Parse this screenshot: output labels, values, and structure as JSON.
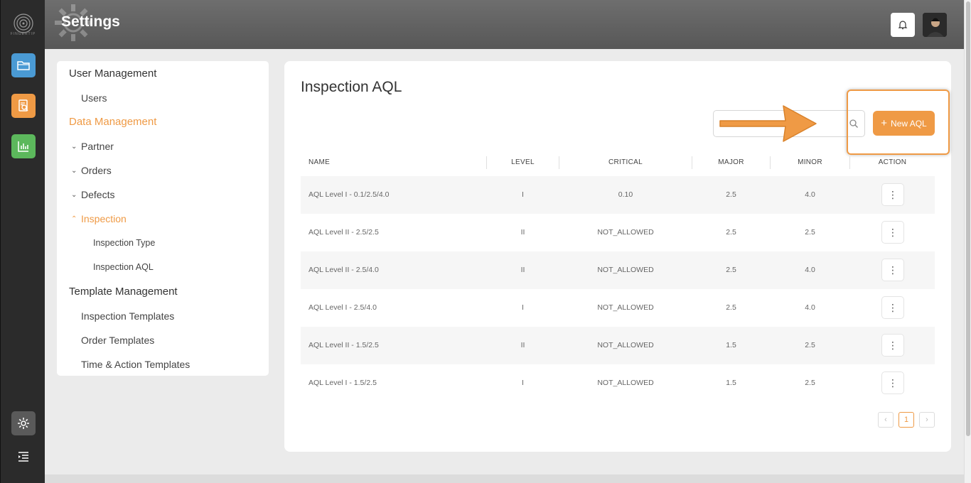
{
  "app": {
    "logo_text": "FINGERTIP",
    "header_title": "Settings",
    "accent_color": "#ef9a45"
  },
  "rail": {
    "items": [
      {
        "icon": "folder-icon"
      },
      {
        "icon": "report-search-icon"
      },
      {
        "icon": "bar-chart-icon"
      },
      {
        "icon": "gear-icon"
      },
      {
        "icon": "menu-indent-icon"
      }
    ]
  },
  "nav": {
    "user_management": "User Management",
    "users": "Users",
    "data_management": "Data Management",
    "partner": "Partner",
    "orders": "Orders",
    "defects": "Defects",
    "inspection": "Inspection",
    "inspection_type": "Inspection Type",
    "inspection_aql": "Inspection AQL",
    "template_management": "Template Management",
    "inspection_templates": "Inspection Templates",
    "order_templates": "Order Templates",
    "time_action_templates": "Time & Action Templates"
  },
  "main": {
    "title": "Inspection AQL",
    "search_value": "",
    "new_button": "New AQL",
    "columns": {
      "name": "NAME",
      "level": "LEVEL",
      "critical": "CRITICAL",
      "major": "MAJOR",
      "minor": "MINOR",
      "action": "ACTION"
    },
    "rows": [
      {
        "name": "AQL Level I - 0.1/2.5/4.0",
        "level": "I",
        "critical": "0.10",
        "major": "2.5",
        "minor": "4.0"
      },
      {
        "name": "AQL Level II - 2.5/2.5",
        "level": "II",
        "critical": "NOT_ALLOWED",
        "major": "2.5",
        "minor": "2.5"
      },
      {
        "name": "AQL Level II - 2.5/4.0",
        "level": "II",
        "critical": "NOT_ALLOWED",
        "major": "2.5",
        "minor": "4.0"
      },
      {
        "name": "AQL Level I - 2.5/4.0",
        "level": "I",
        "critical": "NOT_ALLOWED",
        "major": "2.5",
        "minor": "4.0"
      },
      {
        "name": "AQL Level II - 1.5/2.5",
        "level": "II",
        "critical": "NOT_ALLOWED",
        "major": "1.5",
        "minor": "2.5"
      },
      {
        "name": "AQL Level I - 1.5/2.5",
        "level": "I",
        "critical": "NOT_ALLOWED",
        "major": "1.5",
        "minor": "2.5"
      }
    ],
    "pagination": {
      "prev": "‹",
      "current": "1",
      "next": "›"
    }
  }
}
